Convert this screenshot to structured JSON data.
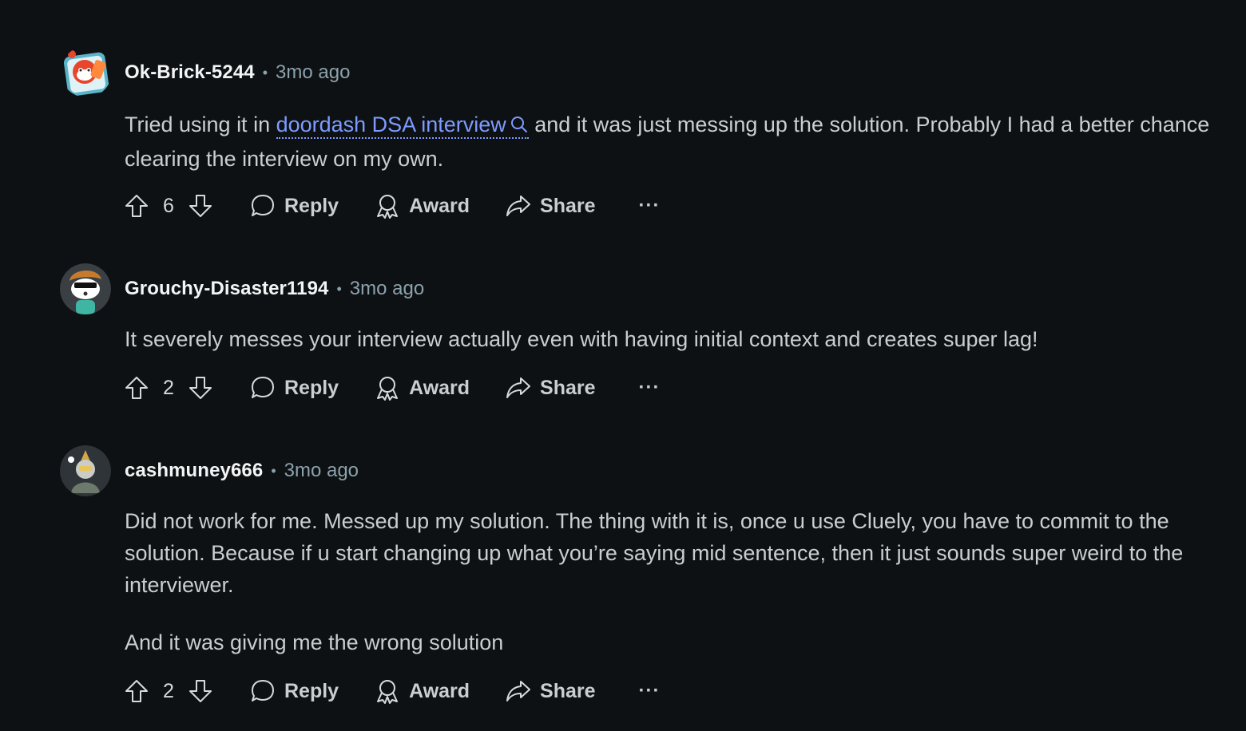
{
  "comments": [
    {
      "username": "Ok-Brick-5244",
      "time": "3mo ago",
      "body_parts": {
        "before": "Tried using it in ",
        "link": "doordash DSA interview",
        "after": " and it was just messing up the solution. Probably I had a better chance clearing the interview on my own."
      },
      "votes": "6",
      "reply": "Reply",
      "award": "Award",
      "share": "Share",
      "more": "···"
    },
    {
      "username": "Grouchy-Disaster1194",
      "time": "3mo ago",
      "paragraphs": [
        "It severely messes your interview actually even with having initial context and creates super lag!"
      ],
      "votes": "2",
      "reply": "Reply",
      "award": "Award",
      "share": "Share",
      "more": "···"
    },
    {
      "username": "cashmuney666",
      "time": "3mo ago",
      "paragraphs": [
        "Did not work for me. Messed up my solution. The thing with it is, once u use Cluely, you have to commit to the solution. Because if u start changing up what you’re saying mid sentence, then it just sounds super weird to the interviewer.",
        "And it was giving me the wrong solution"
      ],
      "votes": "2",
      "reply": "Reply",
      "award": "Award",
      "share": "Share",
      "more": "···"
    }
  ],
  "separator": "•",
  "icons": {
    "upvote": "upvote-arrow-icon",
    "downvote": "downvote-arrow-icon",
    "reply": "speech-bubble-icon",
    "award": "award-ribbon-icon",
    "share": "share-arrow-icon",
    "search": "search-icon"
  },
  "colors": {
    "background": "#0e1113",
    "link": "#7d9bff",
    "meta": "#8ba2ad"
  }
}
